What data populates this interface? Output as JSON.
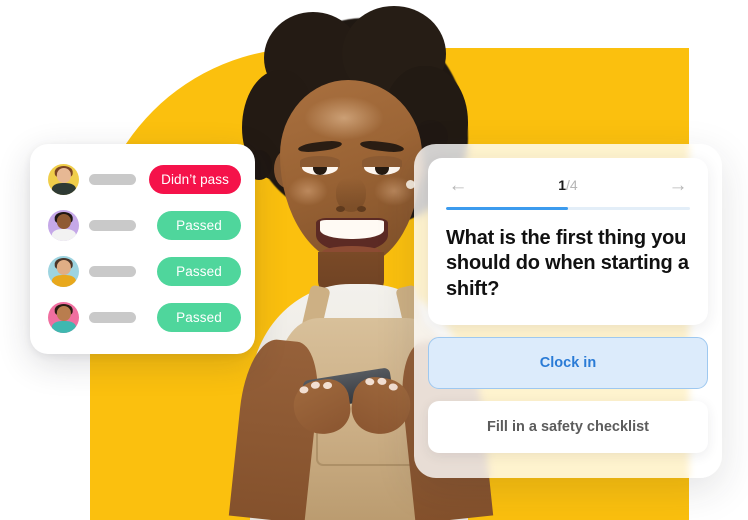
{
  "theme": {
    "background": "#FFFFFF",
    "accent_yellow": "#FBC00E",
    "accent_blue": "#3C9BEE",
    "pass_green": "#4FD69C",
    "fail_red": "#F5124A",
    "selected_bg": "#DCEBFB",
    "selected_border": "#9EC8F0",
    "selected_text": "#2A7BD6",
    "placeholder_gray": "#C9C9C9"
  },
  "results_card": {
    "rows": [
      {
        "name_placeholder": "",
        "status": "Didn’t pass",
        "status_type": "fail",
        "avatar_bg": "#F0CE4A",
        "skin": "#E7B894",
        "hair": "#7B4524",
        "clothes": "#2E3A34"
      },
      {
        "name_placeholder": "",
        "status": "Passed",
        "status_type": "pass",
        "avatar_bg": "#C5A8E8",
        "skin": "#8F5A33",
        "hair": "#1F1713",
        "clothes": "#F2F2F2"
      },
      {
        "name_placeholder": "",
        "status": "Passed",
        "status_type": "pass",
        "avatar_bg": "#9DD4E0",
        "skin": "#E0AE85",
        "hair": "#4A3528",
        "clothes": "#E8A81C"
      },
      {
        "name_placeholder": "",
        "status": "Passed",
        "status_type": "pass",
        "avatar_bg": "#F06FA0",
        "skin": "#B97D4E",
        "hair": "#2A1C13",
        "clothes": "#3FB8B0"
      }
    ]
  },
  "quiz_card": {
    "nav": {
      "prev_icon": "arrow-left-icon",
      "next_icon": "arrow-right-icon",
      "current": "1",
      "separator_total": "/4"
    },
    "progress": {
      "percent": 50
    },
    "question": "What is the first thing you should do when starting a shift?",
    "answers": [
      {
        "label": "Clock in",
        "state": "selected"
      },
      {
        "label": "Fill in a safety checklist",
        "state": "plain"
      }
    ]
  },
  "photo": {
    "alt": "Smiling worker in apron holding a phone"
  }
}
